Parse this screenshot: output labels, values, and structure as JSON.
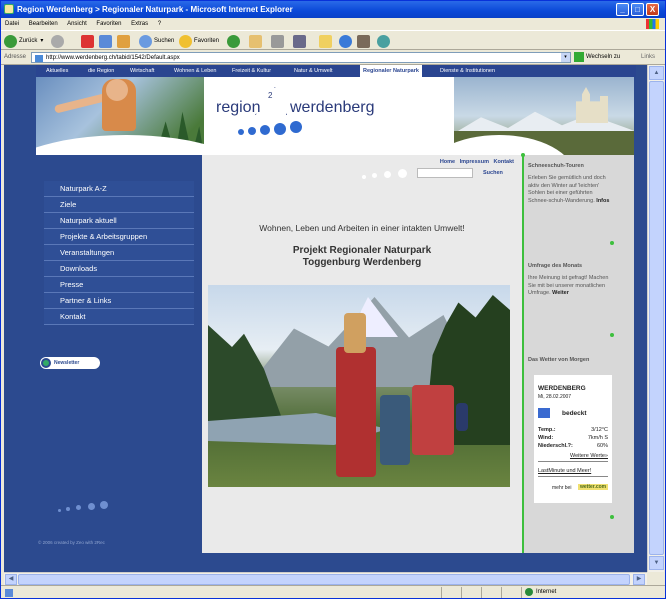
{
  "window": {
    "title": "Region Werdenberg > Regionaler Naturpark - Microsoft Internet Explorer",
    "minimize": "_",
    "maximize": "□",
    "close": "X"
  },
  "menubar": [
    "Datei",
    "Bearbeiten",
    "Ansicht",
    "Favoriten",
    "Extras",
    "?"
  ],
  "toolbar": {
    "back": "Zurück",
    "search": "Suchen",
    "favorites": "Favoriten"
  },
  "address": {
    "label": "Adresse",
    "url": "http://www.werdenberg.ch/tabid/1542/Default.aspx",
    "go": "Wechseln zu",
    "links": "Links"
  },
  "status": {
    "zone": "Internet"
  },
  "site": {
    "topnav": [
      "Aktuelles",
      "die Region",
      "Wirtschaft",
      "Wohnen & Leben",
      "Freizeit & Kultur",
      "Natur & Umwelt",
      "Regionaler Naturpark",
      "Dienste & Institutionen"
    ],
    "logo_left": "region",
    "logo_right": "werdenberg",
    "logo_num": "2",
    "sidenav": [
      "Naturpark A-Z",
      "Ziele",
      "Naturpark aktuell",
      "Projekte & Arbeitsgruppen",
      "Veranstaltungen",
      "Downloads",
      "Presse",
      "Partner & Links",
      "Kontakt"
    ],
    "newsletter": "Newsletter",
    "copyright": "© 2006 created by Zeo with 2Rec",
    "toplinks": [
      "Home",
      "Impressum",
      "Kontakt"
    ],
    "search_label": "Suchen",
    "slogan": "Wohnen, Leben und Arbeiten in einer intakten Umwelt!",
    "project_line1": "Projekt Regionaler Naturpark",
    "project_line2": "Toggenburg Werdenberg",
    "right": {
      "box1_title": "Schneeschuh-Touren",
      "box1_text": "Erleben Sie gemütlich und doch aktiv den Winter auf 'leichten' Sohlen bei einer geführten Schnee-schuh-Wanderung.",
      "box1_link": "Infos",
      "box2_title": "Umfrage des Monats",
      "box2_text": "Ihre Meinung ist gefragt! Machen Sie mit bei unserer monatlichen Umfrage.",
      "box2_link": "Weiter",
      "box3_title": "Das Wetter von Morgen"
    },
    "weather": {
      "place": "WERDENBERG",
      "date": "Mi, 28.02.2007",
      "condition": "bedeckt",
      "temp_label": "Temp.:",
      "temp": "3/12°C",
      "wind_label": "Wind:",
      "wind": "7km/h S",
      "rain_label": "Niederschl.?:",
      "rain": "60%",
      "more": "Weitere Werte»",
      "lastminute": "LastMinute und Meer!",
      "mehr": "mehr bei",
      "brand": "wetter.com"
    }
  }
}
